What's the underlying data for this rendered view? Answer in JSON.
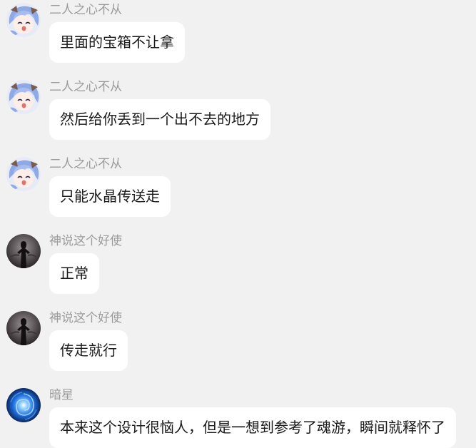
{
  "messages": [
    {
      "sender": "二人之心不从",
      "avatar_icon": "anime-girl-avatar-icon",
      "text": "里面的宝箱不让拿"
    },
    {
      "sender": "二人之心不从",
      "avatar_icon": "anime-girl-avatar-icon",
      "text": "然后给你丢到一个出不去的地方"
    },
    {
      "sender": "二人之心不从",
      "avatar_icon": "anime-girl-avatar-icon",
      "text": "只能水晶传送走"
    },
    {
      "sender": "神说这个好使",
      "avatar_icon": "dark-figure-avatar-icon",
      "text": "正常"
    },
    {
      "sender": "神说这个好使",
      "avatar_icon": "dark-figure-avatar-icon",
      "text": "传走就行"
    },
    {
      "sender": "暗星",
      "avatar_icon": "blue-vortex-avatar-icon",
      "text": "本来这个设计很恼人，但是一想到参考了魂游，瞬间就释怀了"
    }
  ],
  "colors": {
    "background": "#f1f1f1",
    "bubble": "#ffffff",
    "sender_name": "#9b9b9b",
    "text": "#1a1a1a"
  }
}
